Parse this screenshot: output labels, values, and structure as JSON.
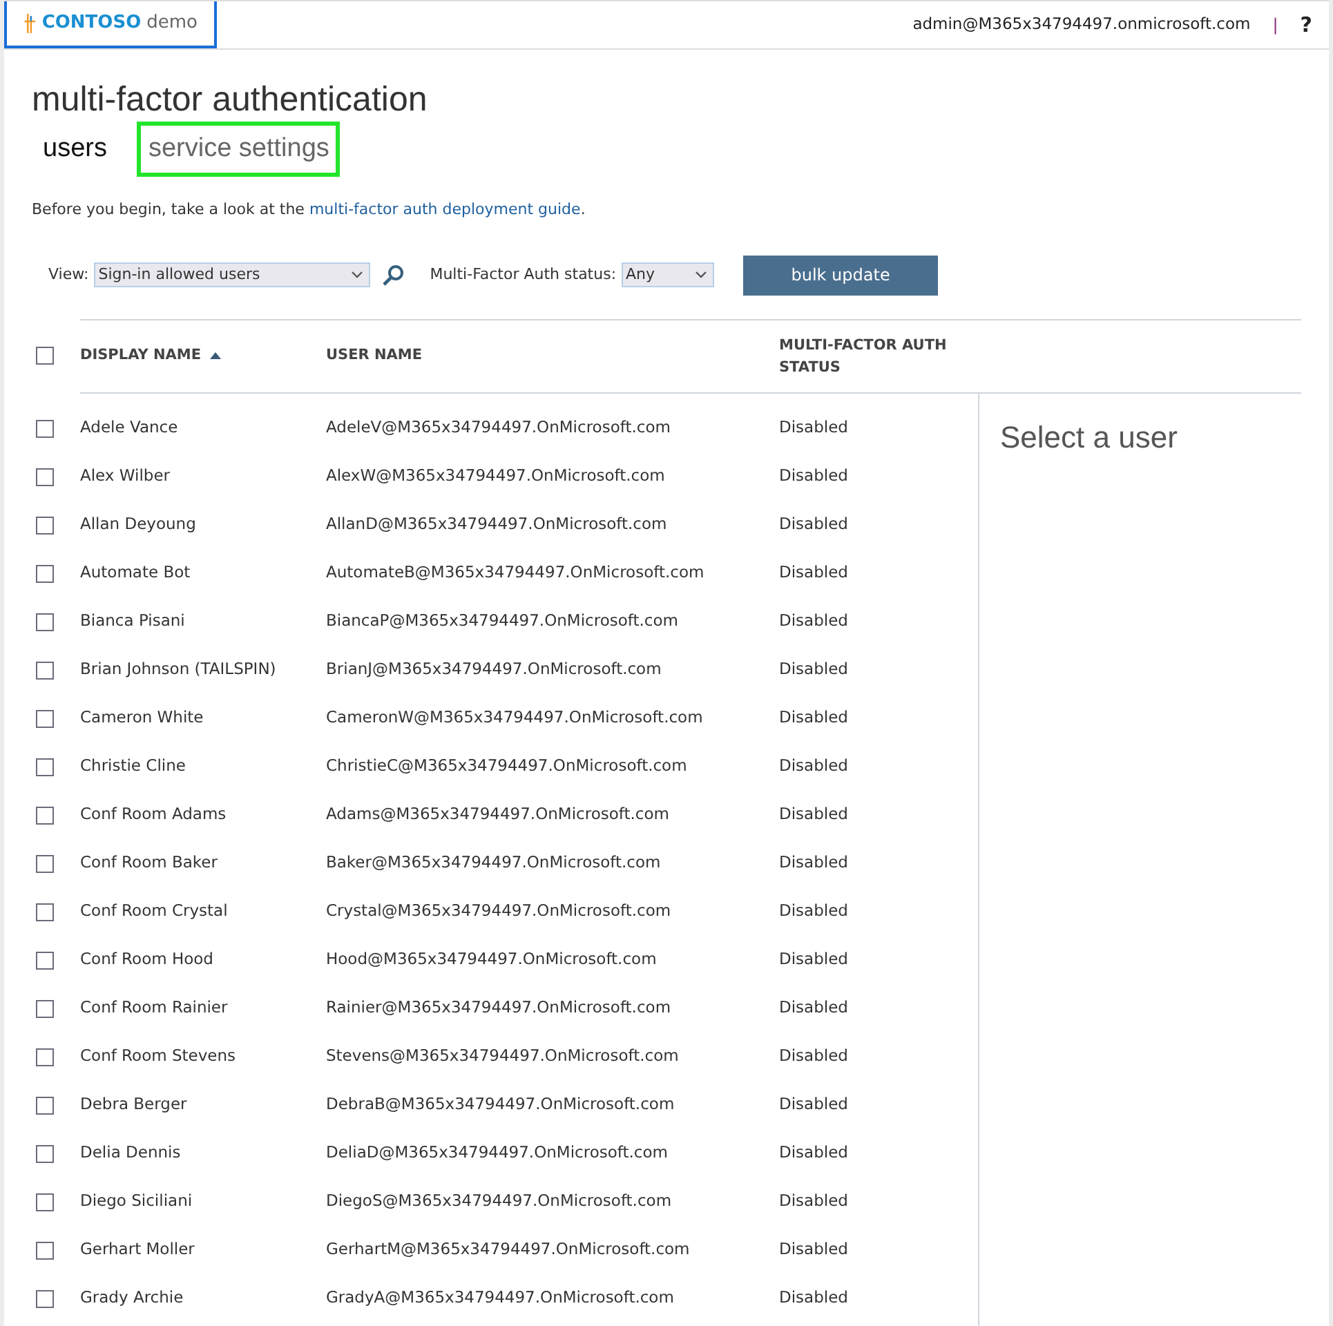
{
  "header": {
    "brand": "CONTOSO",
    "brand_suffix": "demo",
    "account": "admin@M365x34794497.onmicrosoft.com",
    "separator": "|",
    "help": "?"
  },
  "title": "multi-factor authentication",
  "tabs": [
    {
      "label": "users",
      "selected": true,
      "highlighted": false
    },
    {
      "label": "service settings",
      "selected": false,
      "highlighted": true
    }
  ],
  "intro": {
    "before": "Before you begin, take a look at the ",
    "link": "multi-factor auth deployment guide",
    "after": "."
  },
  "filters": {
    "view_label": "View:",
    "view_value": "Sign-in allowed users",
    "status_label": "Multi-Factor Auth status:",
    "status_value": "Any",
    "bulk_button": "bulk update"
  },
  "table": {
    "select_all_checked": false,
    "columns": [
      "DISPLAY NAME",
      "USER NAME",
      "MULTI-FACTOR AUTH STATUS"
    ],
    "rows": [
      {
        "display_name": "Adele Vance",
        "user_name": "AdeleV@M365x34794497.OnMicrosoft.com",
        "status": "Disabled",
        "checked": false
      },
      {
        "display_name": "Alex Wilber",
        "user_name": "AlexW@M365x34794497.OnMicrosoft.com",
        "status": "Disabled",
        "checked": false
      },
      {
        "display_name": "Allan Deyoung",
        "user_name": "AllanD@M365x34794497.OnMicrosoft.com",
        "status": "Disabled",
        "checked": false
      },
      {
        "display_name": "Automate Bot",
        "user_name": "AutomateB@M365x34794497.OnMicrosoft.com",
        "status": "Disabled",
        "checked": false
      },
      {
        "display_name": "Bianca Pisani",
        "user_name": "BiancaP@M365x34794497.OnMicrosoft.com",
        "status": "Disabled",
        "checked": false
      },
      {
        "display_name": "Brian Johnson (TAILSPIN)",
        "user_name": "BrianJ@M365x34794497.OnMicrosoft.com",
        "status": "Disabled",
        "checked": false
      },
      {
        "display_name": "Cameron White",
        "user_name": "CameronW@M365x34794497.OnMicrosoft.com",
        "status": "Disabled",
        "checked": false
      },
      {
        "display_name": "Christie Cline",
        "user_name": "ChristieC@M365x34794497.OnMicrosoft.com",
        "status": "Disabled",
        "checked": false
      },
      {
        "display_name": "Conf Room Adams",
        "user_name": "Adams@M365x34794497.OnMicrosoft.com",
        "status": "Disabled",
        "checked": false
      },
      {
        "display_name": "Conf Room Baker",
        "user_name": "Baker@M365x34794497.OnMicrosoft.com",
        "status": "Disabled",
        "checked": false
      },
      {
        "display_name": "Conf Room Crystal",
        "user_name": "Crystal@M365x34794497.OnMicrosoft.com",
        "status": "Disabled",
        "checked": false
      },
      {
        "display_name": "Conf Room Hood",
        "user_name": "Hood@M365x34794497.OnMicrosoft.com",
        "status": "Disabled",
        "checked": false
      },
      {
        "display_name": "Conf Room Rainier",
        "user_name": "Rainier@M365x34794497.OnMicrosoft.com",
        "status": "Disabled",
        "checked": false
      },
      {
        "display_name": "Conf Room Stevens",
        "user_name": "Stevens@M365x34794497.OnMicrosoft.com",
        "status": "Disabled",
        "checked": false
      },
      {
        "display_name": "Debra Berger",
        "user_name": "DebraB@M365x34794497.OnMicrosoft.com",
        "status": "Disabled",
        "checked": false
      },
      {
        "display_name": "Delia Dennis",
        "user_name": "DeliaD@M365x34794497.OnMicrosoft.com",
        "status": "Disabled",
        "checked": false
      },
      {
        "display_name": "Diego Siciliani",
        "user_name": "DiegoS@M365x34794497.OnMicrosoft.com",
        "status": "Disabled",
        "checked": false
      },
      {
        "display_name": "Gerhart Moller",
        "user_name": "GerhartM@M365x34794497.OnMicrosoft.com",
        "status": "Disabled",
        "checked": false
      },
      {
        "display_name": "Grady Archie",
        "user_name": "GradyA@M365x34794497.OnMicrosoft.com",
        "status": "Disabled",
        "checked": false
      }
    ]
  },
  "detail": {
    "prompt": "Select a user"
  }
}
